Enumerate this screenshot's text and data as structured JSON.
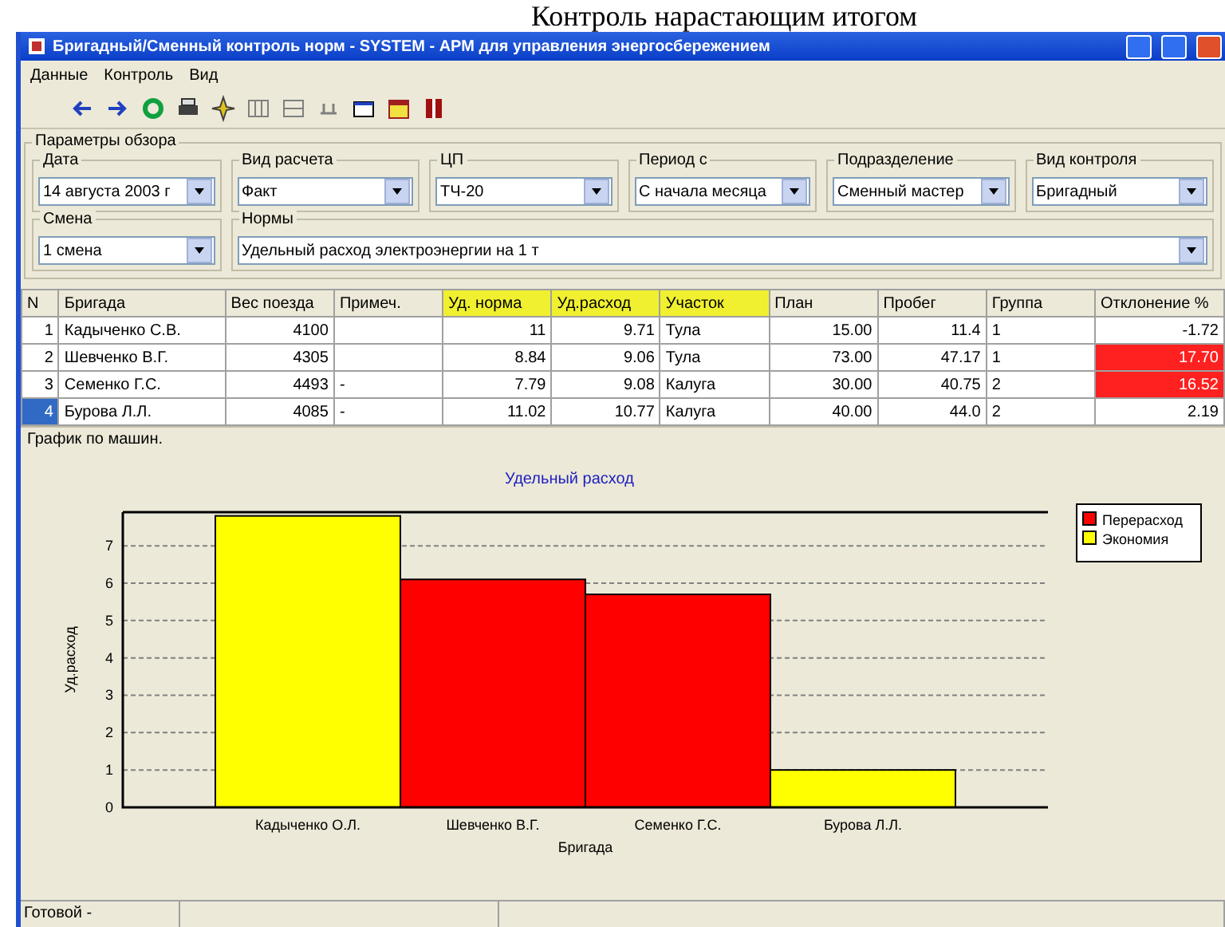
{
  "caption": "Контроль нарастающим итогом",
  "window": {
    "title": "Бригадный/Сменный контроль норм - SYSTEM - АРМ для управления энергосбережением"
  },
  "menu": [
    "Данные",
    "Контроль",
    "Вид"
  ],
  "params": {
    "title": "Параметры обзора",
    "fields": [
      {
        "label": "Дата",
        "value": "14 августа 2003 г"
      },
      {
        "label": "Вид расчета",
        "value": "Факт"
      },
      {
        "label": "ЦП",
        "value": "ТЧ-20"
      },
      {
        "label": "Период с",
        "value": "С начала месяца"
      },
      {
        "label": "Подразделение",
        "value": "Сменный мастер"
      },
      {
        "label": "Вид контроля",
        "value": "Бригадный"
      },
      {
        "label": "Смена",
        "value": "1 смена"
      },
      {
        "label": "Нормы",
        "value": "Удельный расход электроэнергии на 1 т"
      }
    ]
  },
  "table": {
    "columns": [
      {
        "label": "N",
        "highlighted": false
      },
      {
        "label": "Бригада",
        "highlighted": false
      },
      {
        "label": "Вес поезда",
        "highlighted": false
      },
      {
        "label": "Примеч.",
        "highlighted": false
      },
      {
        "label": "Уд. норма",
        "highlighted": true
      },
      {
        "label": "Уд.расход",
        "highlighted": true
      },
      {
        "label": "Участок",
        "highlighted": true
      },
      {
        "label": "План",
        "highlighted": false
      },
      {
        "label": "Пробег",
        "highlighted": false
      },
      {
        "label": "Группа",
        "highlighted": false
      },
      {
        "label": "Отклонение %",
        "highlighted": false
      }
    ],
    "rows": [
      {
        "selected": false,
        "exceeded": false,
        "cells": [
          "1",
          "Кадыченко С.В.",
          "4100",
          "",
          "11",
          "9.71",
          "Тула",
          "15.00",
          "11.4",
          "1",
          "-1.72"
        ]
      },
      {
        "selected": false,
        "exceeded": true,
        "cells": [
          "2",
          "Шевченко В.Г.",
          "4305",
          "",
          "8.84",
          "9.06",
          "Тула",
          "73.00",
          "47.17",
          "1",
          "17.70"
        ]
      },
      {
        "selected": false,
        "exceeded": true,
        "cells": [
          "3",
          "Семенко Г.С.",
          "4493",
          "-",
          "7.79",
          "9.08",
          "Калуга",
          "30.00",
          "40.75",
          "2",
          "16.52"
        ]
      },
      {
        "selected": true,
        "exceeded": false,
        "cells": [
          "4",
          "Бурова Л.Л.",
          "4085",
          "-",
          "11.02",
          "10.77",
          "Калуга",
          "40.00",
          "44.0",
          "2",
          "2.19"
        ]
      }
    ]
  },
  "chart_group": {
    "title": "График по машин.",
    "chart_data": {
      "type": "bar",
      "title": "Удельный расход",
      "xlabel": "Бригада",
      "ylabel": "Уд.расход",
      "categories": [
        "Кадыченко О.Л.",
        "Шевченко В.Г.",
        "Семенко Г.С.",
        "Бурова Л.Л."
      ],
      "series": [
        {
          "name": "Перерасход",
          "color": "#ff0000",
          "values": [
            null,
            6.1,
            5.7,
            null
          ]
        },
        {
          "name": "Экономия",
          "color": "#ffff00",
          "values": [
            7.8,
            null,
            null,
            1.0
          ]
        }
      ],
      "ylim": [
        0,
        7.9
      ],
      "yticks": [
        {
          "value": 0,
          "label": "0"
        },
        {
          "value": 1,
          "label": "1"
        },
        {
          "value": 2,
          "label": "2"
        },
        {
          "value": 3,
          "label": "3"
        },
        {
          "value": 4,
          "label": "4"
        },
        {
          "value": 5,
          "label": "5"
        },
        {
          "value": 6,
          "label": "6"
        },
        {
          "value": 7,
          "label": "7"
        }
      ],
      "grid": true,
      "legend": true
    }
  },
  "status_bar": [
    "Готовой -"
  ]
}
